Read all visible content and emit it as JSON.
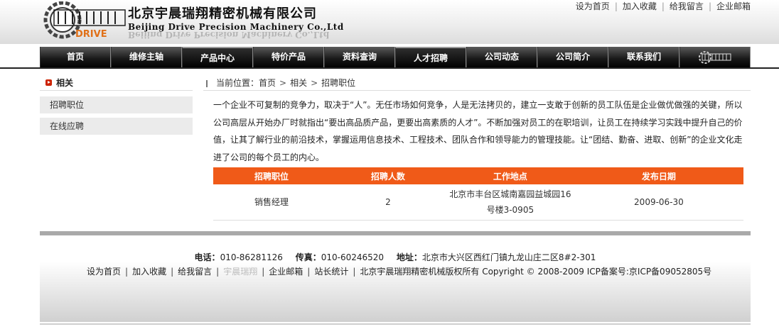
{
  "header": {
    "company_cn": "北京宇晨瑞翔精密机械有限公司",
    "company_en": "Beijing Drive Precision Machinery Co.,Ltd",
    "logo_text": "DRIVE",
    "top_links": [
      "设为首页",
      "加入收藏",
      "给我留言",
      "企业邮箱"
    ]
  },
  "nav": {
    "items": [
      "首页",
      "维修主轴",
      "产品中心",
      "特价产品",
      "资料查询",
      "人才招聘",
      "公司动态",
      "公司简介",
      "联系我们"
    ],
    "active": [
      "产品中心",
      "人才招聘"
    ]
  },
  "sidebar": {
    "title": "相关",
    "items": [
      "招聘职位",
      "在线应聘"
    ]
  },
  "breadcrumb": {
    "label": "当前位置：",
    "items": [
      "首页",
      "相关",
      "招聘职位"
    ]
  },
  "intro": "一个企业不可复制的竞争力，取决于“人”。无任市场如何竞争，人是无法拷贝的，建立一支敢于创新的员工队伍是企业做优做强的关键，所以公司高层从开始办厂时就指出“要出高品质产品，更要出高素质的人才”。不断加强对员工的在职培训，让员工在持续学习实践中提升自己的价值，让其了解行业的前沿技术，掌握运用信息技术、工程技术、团队合作和领导能力的管理技能。让“团结、勤奋、进取、创新”的企业文化走进了公司的每个员工的内心。",
  "table": {
    "headers": [
      "招聘职位",
      "招聘人数",
      "工作地点",
      "发布日期"
    ],
    "rows": [
      {
        "title": "销售经理",
        "count": "2",
        "location": "北京市丰台区城南嘉园益城园16号楼3-0905",
        "date": "2009-06-30"
      }
    ]
  },
  "footer": {
    "phone_label": "电话：",
    "phone": "010-86281126",
    "fax_label": "传真：",
    "fax": "010-60246520",
    "address_label": "地址：",
    "address": "北京市大兴区西红门镇九龙山庄二区8#2-301",
    "links": [
      "设为首页",
      "加入收藏",
      "给我留言",
      "宇晨瑞翔",
      "企业邮箱",
      "站长统计"
    ],
    "copyright": "北京宇晨瑞翔精密机械版权所有 Copyright © 2008-2009",
    "icp": "ICP备案号:京ICP备09052805号"
  },
  "colors": {
    "accent": "#f05a18",
    "nav_bg": "#111111",
    "sidebar_item_bg": "#ebebeb"
  },
  "icons": [
    "gear-logo-icon",
    "bullet-arrow-icon",
    "breadcrumb-icon"
  ]
}
